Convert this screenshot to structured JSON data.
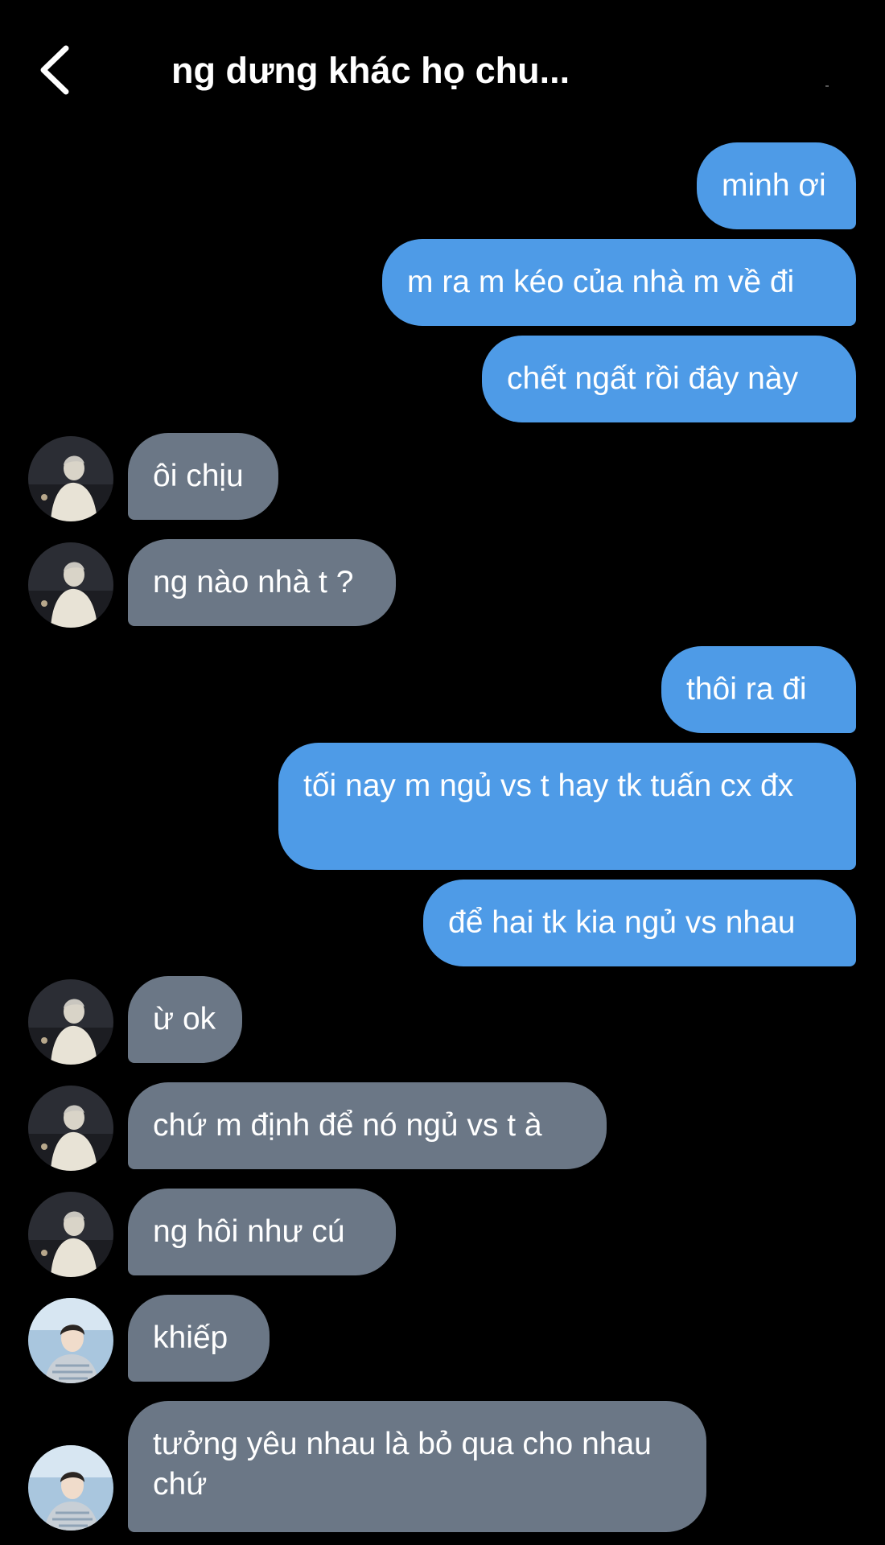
{
  "header": {
    "title": "ng dưng khác họ chu...",
    "back_icon": "chevron-left-icon"
  },
  "messages": [
    {
      "side": "outgoing",
      "text": "minh ơi"
    },
    {
      "side": "outgoing",
      "text": "m ra m kéo của nhà m về đi"
    },
    {
      "side": "outgoing",
      "text": "chết ngất rồi đây này"
    },
    {
      "side": "incoming",
      "sender_avatar": "avatar-a",
      "text": "ôi chịu"
    },
    {
      "side": "incoming",
      "sender_avatar": "avatar-a",
      "text": "ng nào nhà t ?"
    },
    {
      "side": "outgoing",
      "text": "thôi ra đi"
    },
    {
      "side": "outgoing",
      "text": "tối nay m ngủ vs t hay tk tuấn cx đx"
    },
    {
      "side": "outgoing",
      "text": "để hai tk kia ngủ vs nhau"
    },
    {
      "side": "incoming",
      "sender_avatar": "avatar-a",
      "text": "ừ ok"
    },
    {
      "side": "incoming",
      "sender_avatar": "avatar-a",
      "text": "chứ m định để nó ngủ vs t à"
    },
    {
      "side": "incoming",
      "sender_avatar": "avatar-a",
      "text": "ng hôi như cú"
    },
    {
      "side": "incoming",
      "sender_avatar": "avatar-b",
      "text": "khiếp"
    },
    {
      "side": "incoming",
      "sender_avatar": "avatar-b",
      "text": "tưởng yêu nhau là bỏ qua cho nhau chứ"
    }
  ],
  "colors": {
    "background": "#000000",
    "outgoing_bubble": "#4e9be7",
    "incoming_bubble": "#6b7786",
    "text": "#ffffff"
  }
}
